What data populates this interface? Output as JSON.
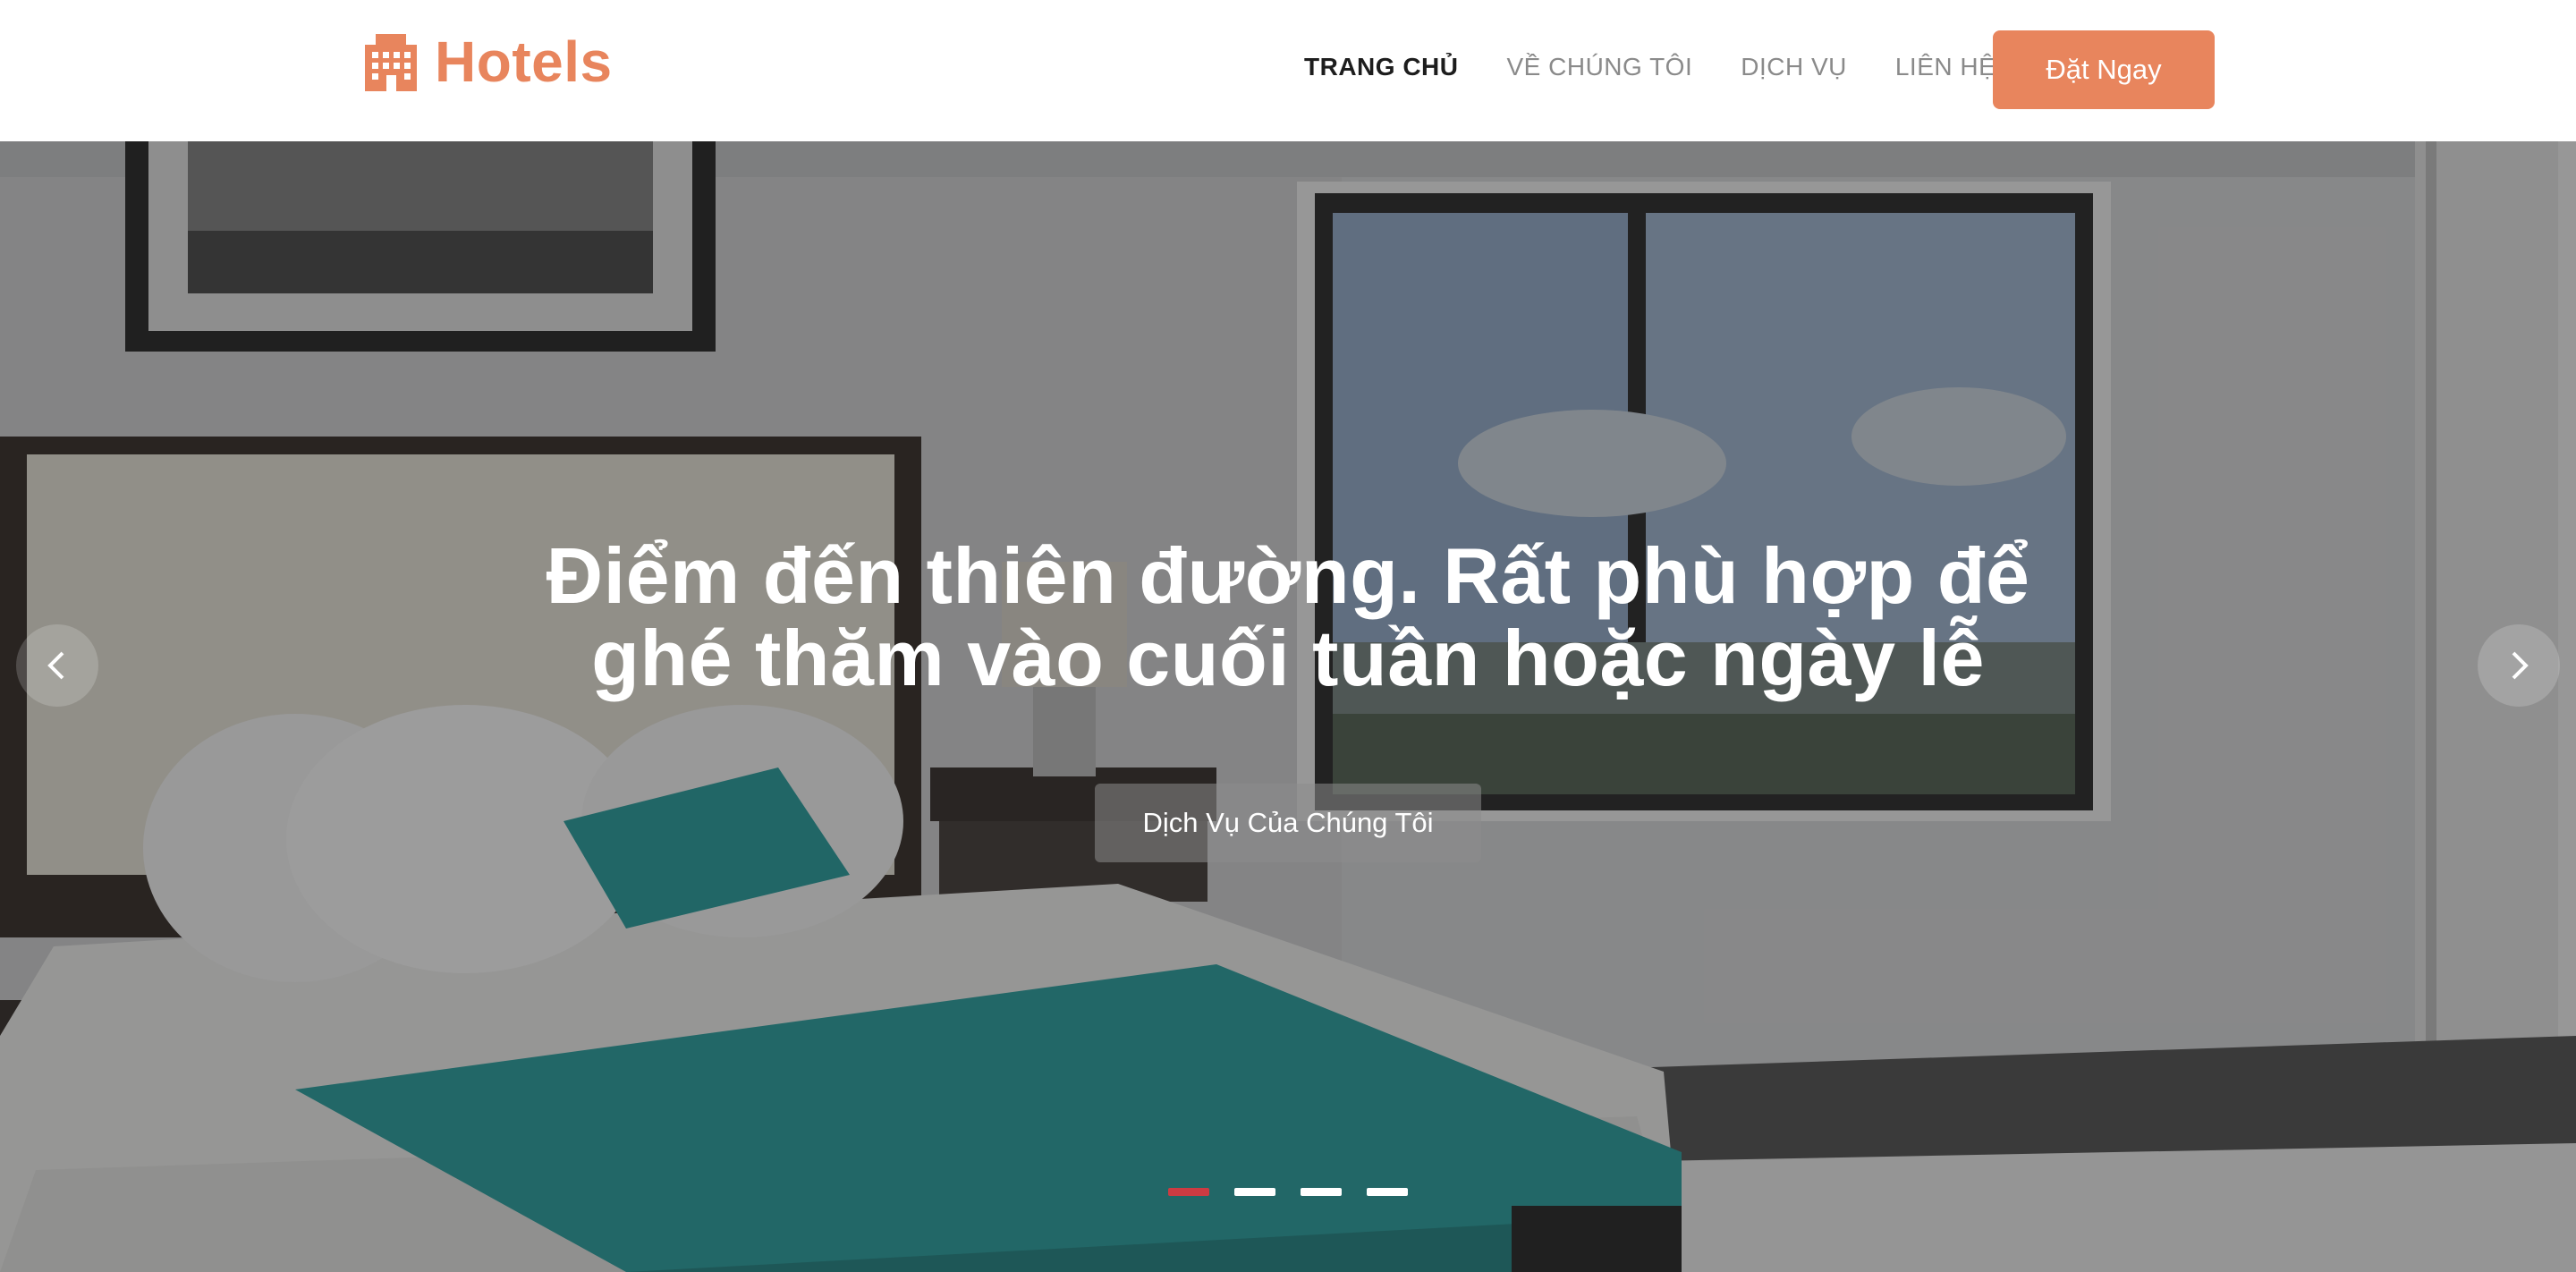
{
  "brand": {
    "name": "Hotels",
    "icon": "building-icon",
    "color": "#e8855d"
  },
  "nav": {
    "items": [
      {
        "label": "TRANG CHỦ",
        "active": true
      },
      {
        "label": "VỀ CHÚNG TÔI",
        "active": false
      },
      {
        "label": "DỊCH VỤ",
        "active": false
      },
      {
        "label": "LIÊN HỆ",
        "active": false
      }
    ],
    "cta_label": "Đặt Ngay"
  },
  "hero": {
    "title": "Điểm đến thiên đường. Rất phù hợp để ghé thăm vào cuối tuần hoặc ngày lễ",
    "button_label": "Dịch Vụ Của Chúng Tôi",
    "prev_icon": "chevron-left-icon",
    "next_icon": "chevron-right-icon",
    "slides_count": 4,
    "active_slide": 1,
    "active_indicator_color": "#cc3b42"
  }
}
